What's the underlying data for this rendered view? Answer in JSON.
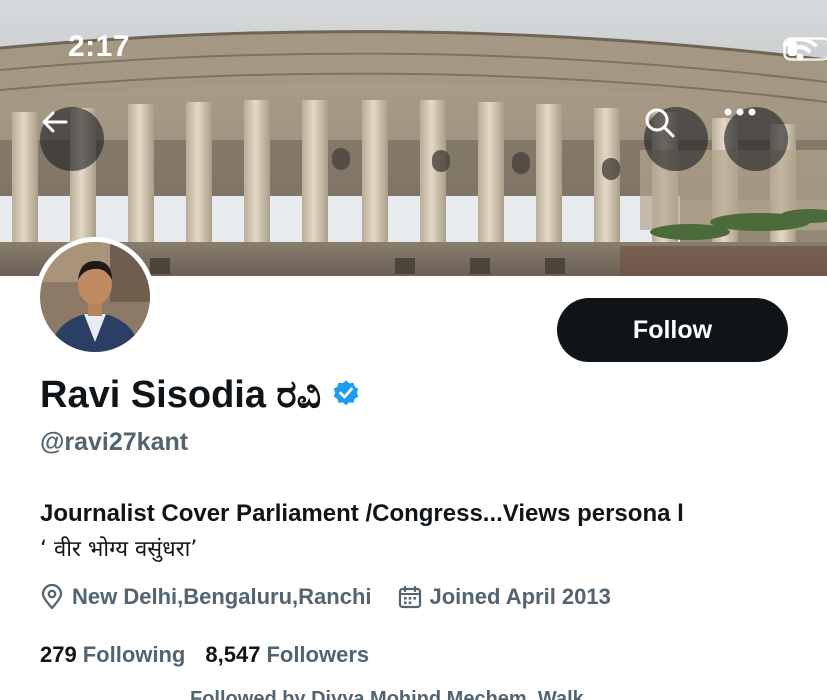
{
  "status_bar": {
    "time": "2:17",
    "icons": [
      "wifi-icon",
      "battery-icon"
    ]
  },
  "header": {
    "back_icon": "arrow-left-icon",
    "search_icon": "search-icon",
    "more_icon": "more-horizontal-icon",
    "banner_subject": "parliament-building-photo"
  },
  "profile": {
    "display_name": "Ravi Sisodia ರವಿ",
    "verified_icon": "verified-badge-icon",
    "verified_color": "#1d9bf0",
    "handle": "@ravi27kant",
    "follow_label": "Follow",
    "bio_line1": "Journalist Cover Parliament /Congress...Views persona l",
    "bio_line2": "‘ वीर भोग्य वसुंधरा’",
    "location_icon": "location-pin-icon",
    "location": "New Delhi,Bengaluru,Ranchi",
    "joined_icon": "calendar-icon",
    "joined": "Joined April 2013",
    "following_count": "279",
    "following_label": "Following",
    "followers_count": "8,547",
    "followers_label": "Followers",
    "followed_by": "Followed by Divya Mohind Mechem, Walk..."
  },
  "colors": {
    "text_primary": "#0f1419",
    "text_secondary": "#536471",
    "follow_bg": "#0f1419",
    "follow_text": "#ffffff"
  }
}
